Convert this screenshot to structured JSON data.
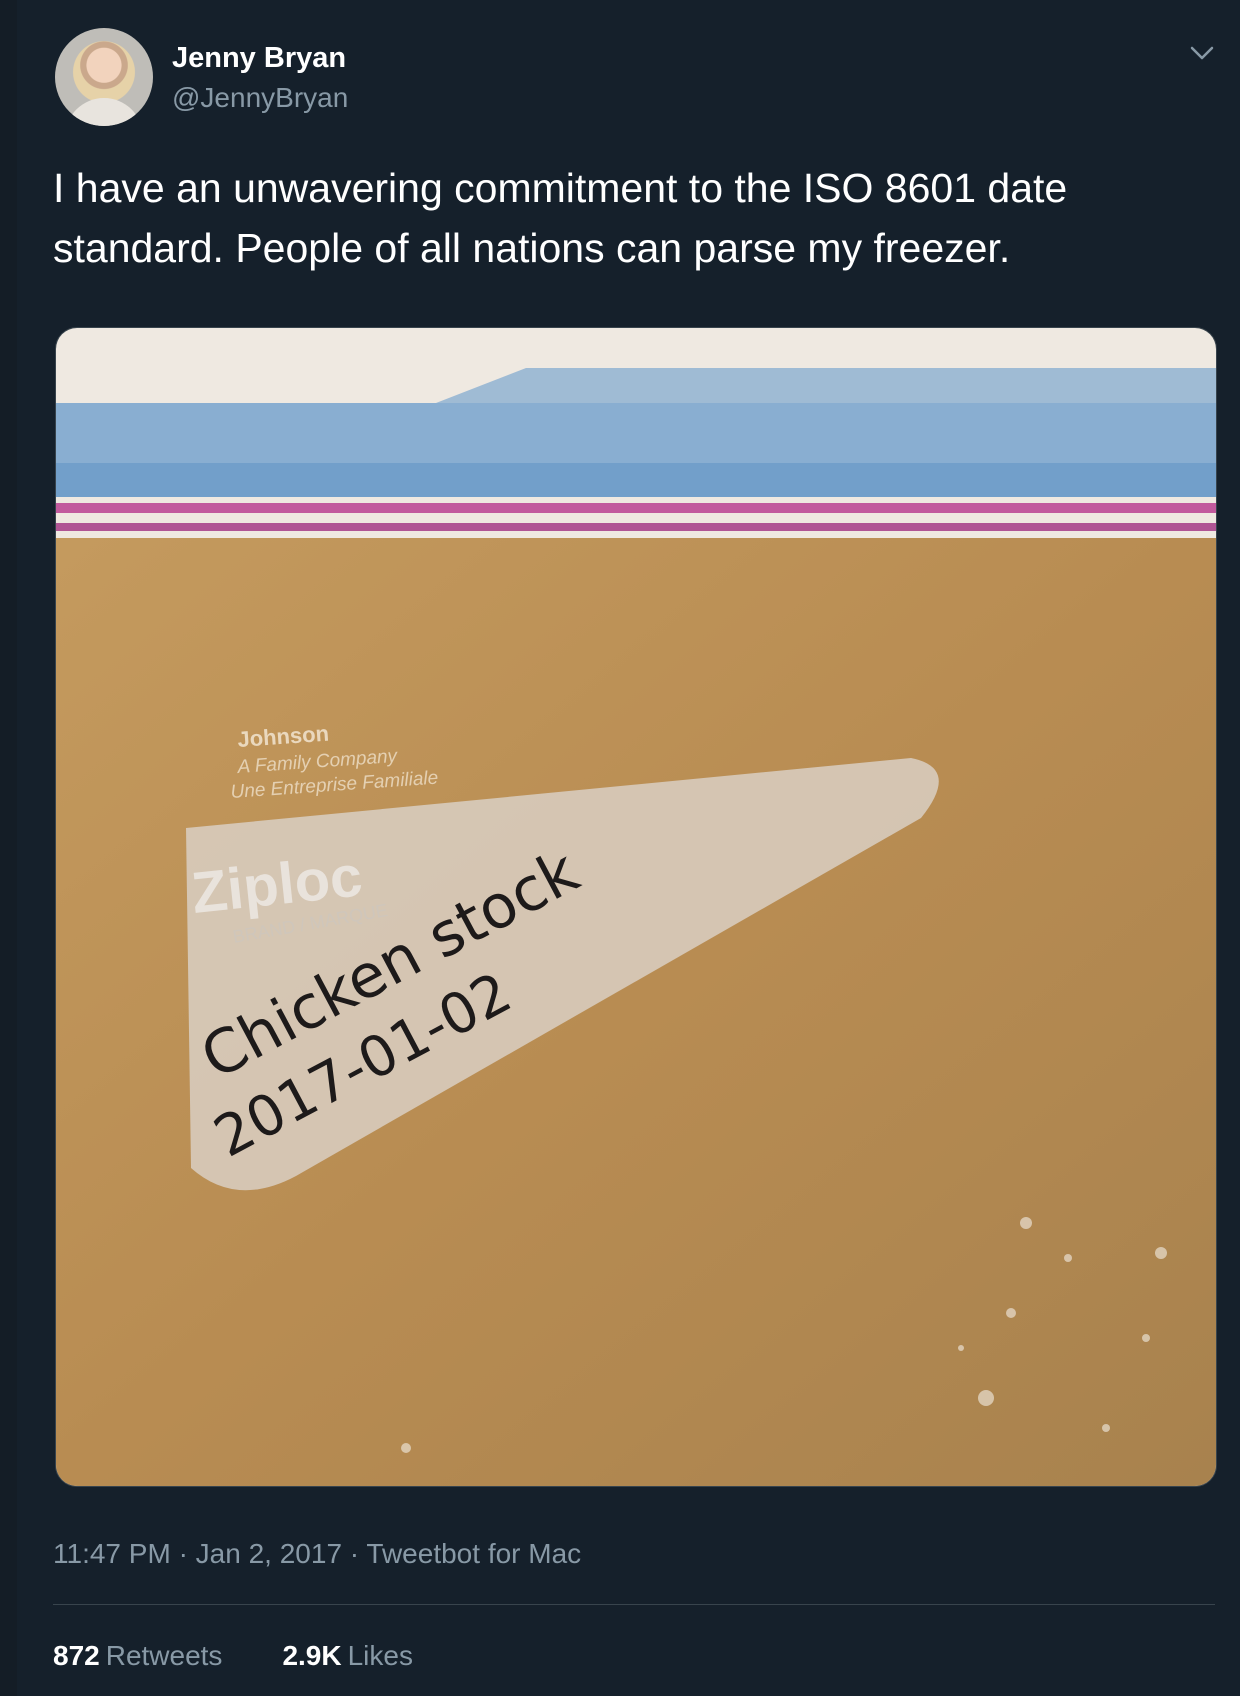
{
  "tweet": {
    "author_name": "Jenny Bryan",
    "author_handle": "@JennyBryan",
    "text": "I have an unwavering commitment to the ISO 8601 date standard. People of all nations can parse my freezer.",
    "time": "11:47 PM",
    "date": "Jan 2, 2017",
    "source": "Tweetbot for Mac",
    "separator": "·",
    "retweets_count": "872",
    "retweets_label": "Retweets",
    "likes_count": "2.9K",
    "likes_label": "Likes"
  },
  "photo": {
    "brand_lines": [
      "Johnson",
      "A Family Company",
      "Une Entreprise Familiale"
    ],
    "brand": "Ziploc",
    "brand_sub": "BRAND / MARQUE",
    "handwriting_line1": "Chicken stock",
    "handwriting_line2": "2017-01-02"
  },
  "icons": {
    "menu": "chevron-down-icon"
  },
  "colors": {
    "background": "#15202b",
    "secondary_text": "#8899a6",
    "divider": "#38444d"
  }
}
